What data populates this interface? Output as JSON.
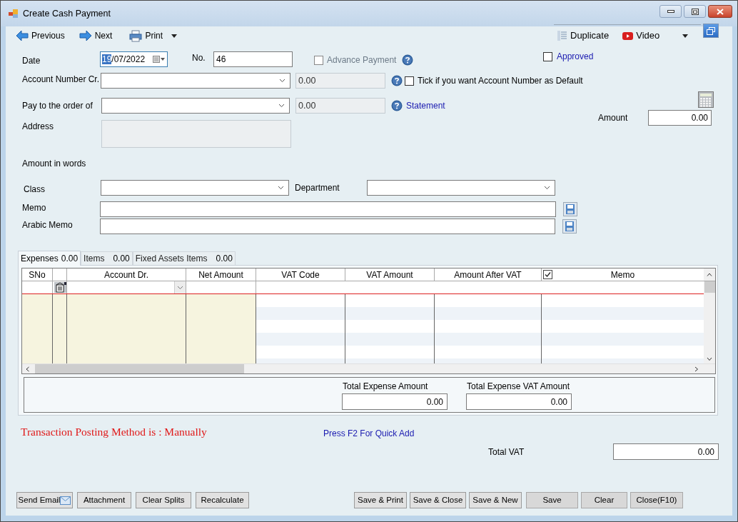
{
  "window": {
    "title": "Create Cash Payment"
  },
  "toolbar": {
    "left": [
      {
        "kind": "previous",
        "label": "Previous"
      },
      {
        "kind": "next",
        "label": "Next"
      },
      {
        "kind": "print",
        "label": "Print",
        "dropdown": true
      }
    ],
    "right": [
      {
        "kind": "duplicate",
        "label": "Duplicate"
      },
      {
        "kind": "video",
        "label": "Video",
        "dropdown": true
      }
    ]
  },
  "form": {
    "date": {
      "label": "Date",
      "value": "19/07/2022"
    },
    "number": {
      "label": "No.",
      "value": "46"
    },
    "advance_payment": {
      "label": "Advance Payment",
      "checked": false,
      "disabled": true
    },
    "approved": {
      "label": "Approved",
      "checked": false
    },
    "account_number_cr": {
      "label": "Account Number Cr.",
      "balance": "0.00"
    },
    "default_account": {
      "label": "Tick if you want Account Number as Default",
      "checked": false
    },
    "pay_to": {
      "label": "Pay to the order of",
      "balance": "0.00"
    },
    "statement_link": "Statement",
    "amount": {
      "label": "Amount",
      "value": "0.00"
    },
    "address": {
      "label": "Address"
    },
    "amount_in_words": {
      "label": "Amount in words"
    },
    "class": {
      "label": "Class"
    },
    "department": {
      "label": "Department"
    },
    "memo": {
      "label": "Memo"
    },
    "arabic_memo": {
      "label": "Arabic Memo"
    }
  },
  "tabs": [
    {
      "label": "Expenses",
      "total": "0.00",
      "selected": true
    },
    {
      "label": "Items",
      "total": "0.00",
      "selected": false
    },
    {
      "label": "Fixed Assets Items",
      "total": "0.00",
      "selected": false
    }
  ],
  "grid": {
    "columns": [
      {
        "kind": "text",
        "label": "SNo"
      },
      {
        "kind": "blank"
      },
      {
        "kind": "text",
        "label": "Account Dr."
      },
      {
        "kind": "text",
        "label": "Net Amount"
      },
      {
        "kind": "text",
        "label": "VAT Code"
      },
      {
        "kind": "text",
        "label": "VAT Amount"
      },
      {
        "kind": "text",
        "label": "Amount After VAT"
      },
      {
        "kind": "checkbox_text",
        "label": "Memo",
        "checked": true
      }
    ]
  },
  "totals": [
    {
      "label": "Total Expense Amount",
      "value": "0.00"
    },
    {
      "label": "Total Expense VAT Amount",
      "value": "0.00"
    }
  ],
  "posting_method": "Transaction Posting Method is : Manually",
  "quick_add_hint": "Press F2 For Quick Add",
  "total_vat": {
    "label": "Total VAT",
    "value": "0.00"
  },
  "buttons_left": [
    {
      "label": "Send Email",
      "kind": "email"
    },
    {
      "label": "Attachment",
      "kind": "plain"
    },
    {
      "label": "Clear Splits",
      "kind": "plain"
    },
    {
      "label": "Recalculate",
      "kind": "plain"
    }
  ],
  "buttons_right": [
    {
      "label": "Save & Print",
      "kind": "plain"
    },
    {
      "label": "Save & Close",
      "kind": "plain"
    },
    {
      "label": "Save & New",
      "kind": "plain"
    },
    {
      "label": "Save",
      "kind": "flat"
    },
    {
      "label": "Clear",
      "kind": "flat"
    },
    {
      "label": "Close(F10)",
      "kind": "flat"
    }
  ]
}
